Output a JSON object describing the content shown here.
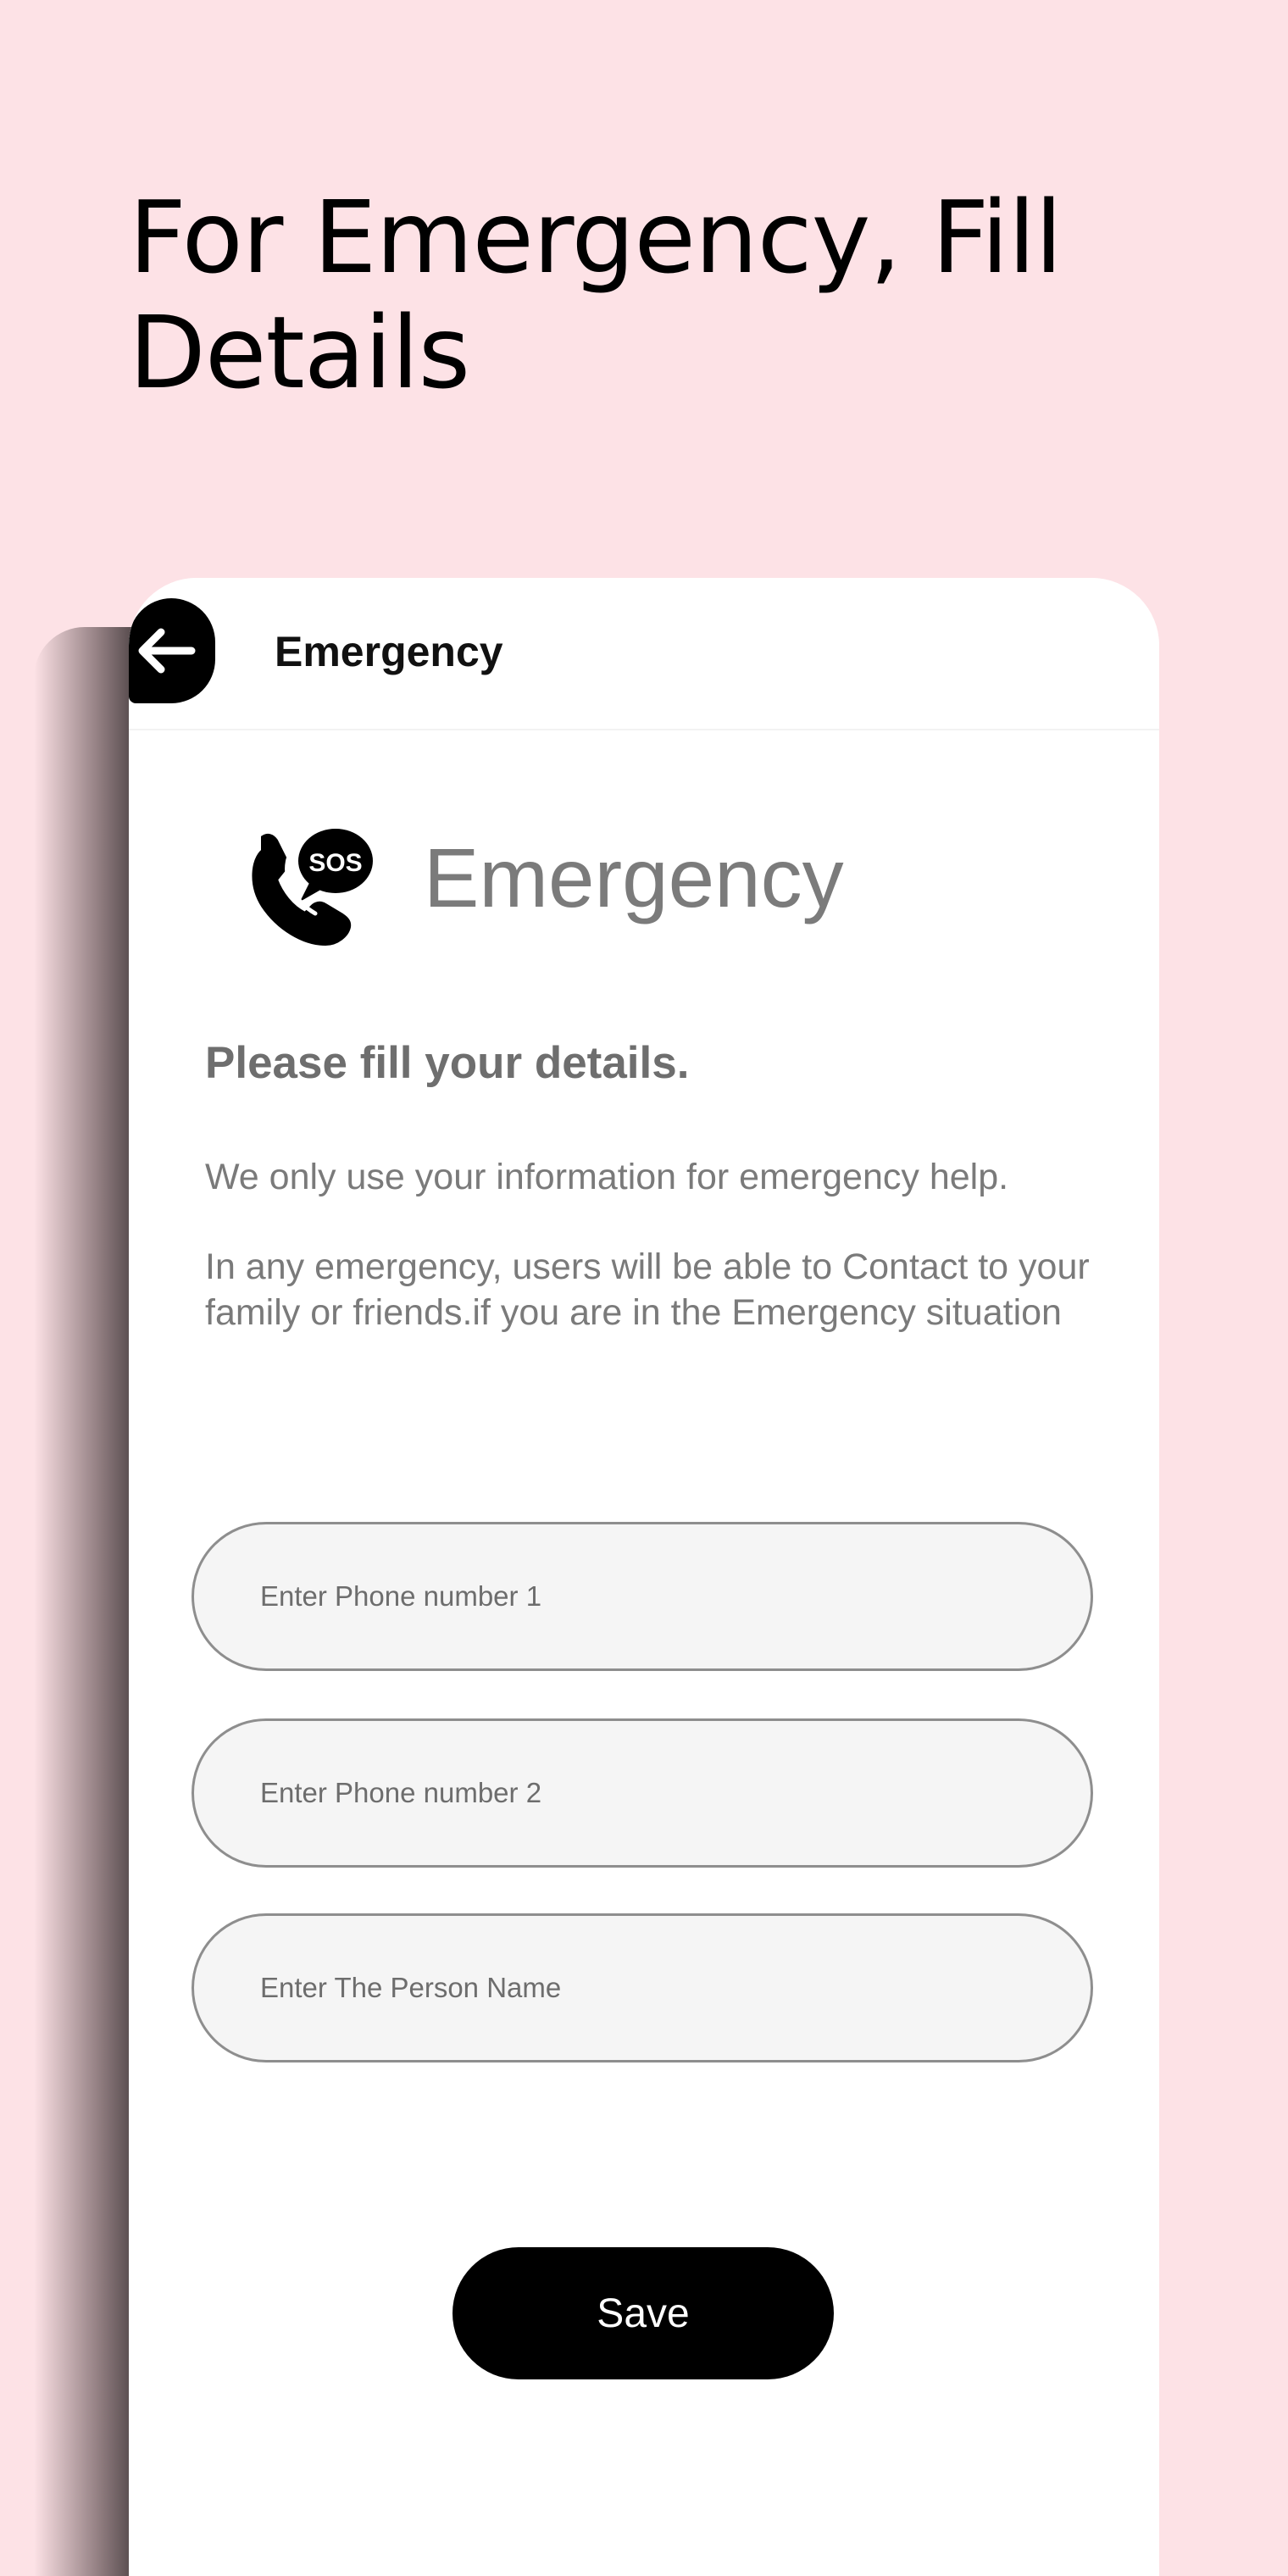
{
  "promo": {
    "title": "For Emergency, Fill Details"
  },
  "app_bar": {
    "title": "Emergency"
  },
  "header": {
    "logo_text": "Emergency",
    "logo_badge": "SOS"
  },
  "content": {
    "subtitle": "Please fill your details.",
    "description_1": "We only use your information for emergency help.",
    "description_2": "In any emergency, users   will be able to Contact to your family or friends.if you are in the Emergency situation"
  },
  "form": {
    "phone1_placeholder": "Enter Phone number 1",
    "phone2_placeholder": "Enter Phone number 2",
    "name_placeholder": "Enter The Person Name",
    "save_label": "Save"
  },
  "colors": {
    "background": "#fde2e6",
    "accent": "#000000",
    "field_background": "#f5f5f5"
  }
}
